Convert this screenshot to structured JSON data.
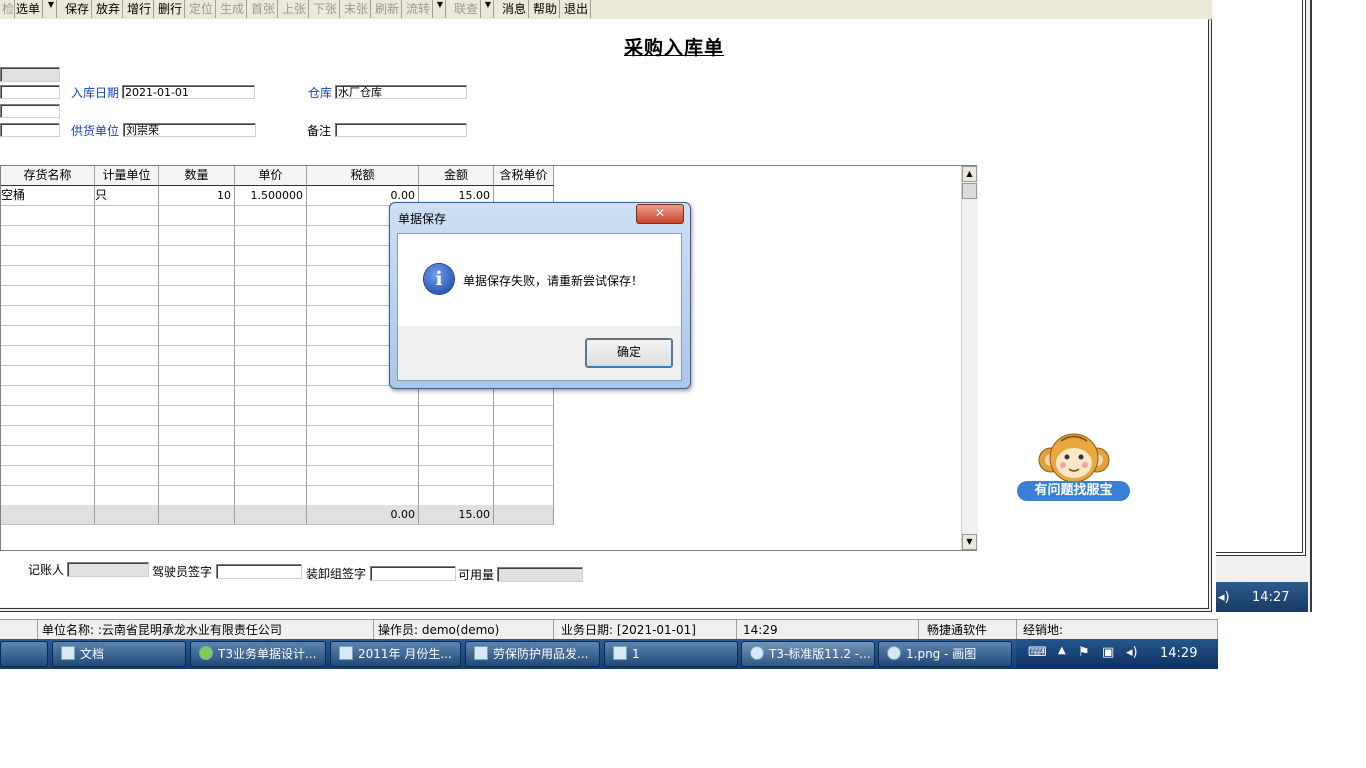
{
  "toolbar": {
    "items": [
      "检",
      "选单",
      "保存",
      "放弃",
      "增行",
      "删行",
      "定位",
      "生成",
      "首张",
      "上张",
      "下张",
      "末张",
      "刷新",
      "流转",
      "联查",
      "消息",
      "帮助",
      "退出"
    ]
  },
  "form": {
    "title": "采购入库单",
    "date_label": "入库日期",
    "date_value": "2021-01-01",
    "warehouse_label": "仓库",
    "warehouse_value": "水厂仓库",
    "supplier_label": "供货单位",
    "supplier_value": "刘崇荣",
    "remark_label": "备注",
    "remark_value": ""
  },
  "grid": {
    "headers": [
      "存货名称",
      "计量单位",
      "数量",
      "单价",
      "税额",
      "金额",
      "含税单价"
    ],
    "rows": [
      {
        "name": "空桶",
        "unit": "只",
        "qty": "10",
        "price": "1.500000",
        "tax": "0.00",
        "amount": "15.00"
      }
    ],
    "sum": {
      "tax": "0.00",
      "amount": "15.00"
    }
  },
  "footer": {
    "bookkeeper_label": "记账人",
    "driver_label": "驾驶员签字",
    "loader_label": "装卸组签字",
    "available_label": "可用量"
  },
  "dialog": {
    "title": "单据保存",
    "close_icon": "✕",
    "message": "单据保存失败，请重新尝试保存！",
    "ok_label": "确定",
    "icon": "i"
  },
  "mascot": {
    "label": "有问题找服宝"
  },
  "statusbar": {
    "company": "单位名称: :云南省昆明承龙水业有限责任公司",
    "operator": "操作员: demo(demo)",
    "bizdate": "业务日期: [2021-01-01]",
    "time": "14:29",
    "vendor": "畅捷通软件",
    "dealer": "经销地:"
  },
  "taskbar": {
    "tasks": [
      "文档",
      "T3业务单据设计...",
      "2011年 月份生...",
      "劳保防护用品发...",
      "1",
      "T3-标准版11.2 -...",
      "1.png - 画图"
    ],
    "clock": "14:29"
  },
  "bgwin": {
    "clock": "14:27"
  }
}
